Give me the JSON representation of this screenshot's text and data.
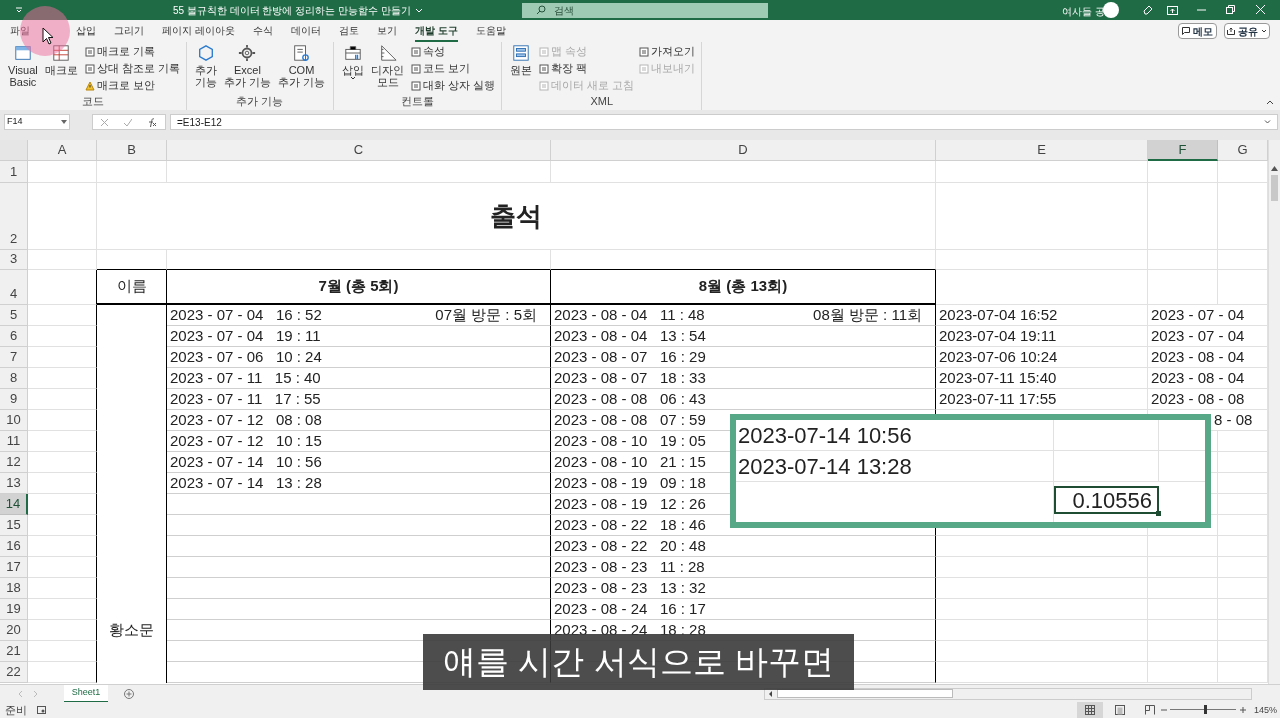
{
  "title_bar": {
    "title": "55 불규칙한 데이터 한방에 정리하는 만능함수 만들기",
    "search_placeholder": "검색",
    "user": "여사들 공"
  },
  "menu_tabs": [
    {
      "label": "파일",
      "selected": false
    },
    {
      "label": "삽입",
      "selected": false
    },
    {
      "label": "그리기",
      "selected": false
    },
    {
      "label": "페이지 레이아웃",
      "selected": false
    },
    {
      "label": "수식",
      "selected": false
    },
    {
      "label": "데이터",
      "selected": false
    },
    {
      "label": "검토",
      "selected": false
    },
    {
      "label": "보기",
      "selected": false
    },
    {
      "label": "개발 도구",
      "selected": true
    },
    {
      "label": "도움말",
      "selected": false
    }
  ],
  "memo_button": "메모",
  "share_button": "공유",
  "ribbon_groups": [
    {
      "label": "코드",
      "columns": [
        {
          "kind": "large",
          "label": "Visual\nBasic",
          "dropdown": false
        },
        {
          "kind": "large",
          "label": "매크로",
          "dropdown": false
        },
        {
          "kind": "stack",
          "items": [
            {
              "label": "매크로 기록",
              "disabled": false
            },
            {
              "label": "상대 참조로 기록",
              "disabled": false
            },
            {
              "label": "매크로 보안",
              "disabled": false
            }
          ]
        }
      ]
    },
    {
      "label": "추가 기능",
      "columns": [
        {
          "kind": "large",
          "label": "추가\n기능",
          "dropdown": false
        },
        {
          "kind": "large",
          "label": "Excel\n추가 기능",
          "dropdown": false
        },
        {
          "kind": "large",
          "label": "COM\n추가 기능",
          "dropdown": false
        }
      ]
    },
    {
      "label": "컨트롤",
      "columns": [
        {
          "kind": "large",
          "label": "삽입",
          "dropdown": true
        },
        {
          "kind": "large",
          "label": "디자인\n모드",
          "dropdown": false
        },
        {
          "kind": "stack",
          "items": [
            {
              "label": "속성",
              "disabled": false
            },
            {
              "label": "코드 보기",
              "disabled": false
            },
            {
              "label": "대화 상자 실행",
              "disabled": false
            }
          ]
        }
      ]
    },
    {
      "label": "XML",
      "columns": [
        {
          "kind": "large",
          "label": "원본",
          "dropdown": false
        },
        {
          "kind": "stack",
          "items": [
            {
              "label": "맵 속성",
              "disabled": true
            },
            {
              "label": "확장 팩",
              "disabled": false
            },
            {
              "label": "데이터 새로 고침",
              "disabled": true
            }
          ]
        },
        {
          "kind": "stack",
          "items": [
            {
              "label": "가져오기",
              "disabled": false
            },
            {
              "label": "내보내기",
              "disabled": true
            }
          ]
        }
      ]
    }
  ],
  "name_box": "F14",
  "formula": "=E13-E12",
  "columns": [
    {
      "label": "A",
      "selected": false
    },
    {
      "label": "B",
      "selected": false
    },
    {
      "label": "C",
      "selected": false
    },
    {
      "label": "D",
      "selected": false
    },
    {
      "label": "E",
      "selected": false
    },
    {
      "label": "F",
      "selected": true
    },
    {
      "label": "G",
      "selected": false
    }
  ],
  "rows": [
    {
      "header": "1",
      "selected": false
    },
    {
      "header": "2",
      "selected": false,
      "title": "출석"
    },
    {
      "header": "3",
      "selected": false
    },
    {
      "header": "4",
      "selected": false,
      "b": "이름",
      "c": "7월 (총 5회)",
      "d": "8월 (총 13회)"
    },
    {
      "header": "5",
      "selected": false,
      "c": "2023 - 07 - 04   16 : 52",
      "c_note": "07월 방문 : 5회",
      "d": "2023 - 08 - 04   11 : 48",
      "d_note": "08월 방문 : 11회",
      "e": "2023-07-04 16:52",
      "f": "2023 - 07 - 04"
    },
    {
      "header": "6",
      "selected": false,
      "c": "2023 - 07 - 04   19 : 11",
      "d": "2023 - 08 - 04   13 : 54",
      "e": "2023-07-04 19:11",
      "f": "2023 - 07 - 04"
    },
    {
      "header": "7",
      "selected": false,
      "c": "2023 - 07 - 06   10 : 24",
      "d": "2023 - 08 - 07   16 : 29",
      "e": "2023-07-06 10:24",
      "f": "2023 - 08 - 04"
    },
    {
      "header": "8",
      "selected": false,
      "c": "2023 - 07 - 11   15 : 40",
      "d": "2023 - 08 - 07   18 : 33",
      "e": "2023-07-11 15:40",
      "f": "2023 - 08 - 04"
    },
    {
      "header": "9",
      "selected": false,
      "c": "2023 - 07 - 11   17 : 55",
      "d": "2023 - 08 - 08   06 : 43",
      "e": "2023-07-11 17:55",
      "f": "2023 - 08 - 08"
    },
    {
      "header": "10",
      "selected": false,
      "c": "2023 - 07 - 12   08 : 08",
      "d": "2023 - 08 - 08   07 : 59",
      "f_partial": "8 - 08"
    },
    {
      "header": "11",
      "selected": false,
      "c": "2023 - 07 - 12   10 : 15",
      "d": "2023 - 08 - 10   19 : 05"
    },
    {
      "header": "12",
      "selected": false,
      "c": "2023 - 07 - 14   10 : 56",
      "d": "2023 - 08 - 10   21 : 15"
    },
    {
      "header": "13",
      "selected": false,
      "c": "2023 - 07 - 14   13 : 28",
      "d": "2023 - 08 - 19   09 : 18"
    },
    {
      "header": "14",
      "selected": true,
      "d": "2023 - 08 - 19   12 : 26"
    },
    {
      "header": "15",
      "selected": false,
      "d": "2023 - 08 - 22   18 : 46"
    },
    {
      "header": "16",
      "selected": false,
      "d": "2023 - 08 - 22   20 : 48"
    },
    {
      "header": "17",
      "selected": false,
      "d": "2023 - 08 - 23   11 : 28"
    },
    {
      "header": "18",
      "selected": false,
      "d": "2023 - 08 - 23   13 : 32"
    },
    {
      "header": "19",
      "selected": false,
      "d": "2023 - 08 - 24   16 : 17"
    },
    {
      "header": "20",
      "selected": false,
      "b": "황소문",
      "d": "2023 - 08 - 24   18 : 28"
    },
    {
      "header": "21",
      "selected": false
    },
    {
      "header": "22",
      "selected": false
    }
  ],
  "callout": {
    "lines": [
      "2023-07-14 10:56",
      "2023-07-14 13:28"
    ],
    "result": "0.10556"
  },
  "caption": "얘를 시간 서식으로 바꾸면",
  "sheet_tabs": [
    {
      "label": "Sheet1",
      "selected": true
    }
  ],
  "status": "준비",
  "views": [
    {
      "kind": "normal",
      "selected": true
    },
    {
      "kind": "page_layout",
      "selected": false
    },
    {
      "kind": "page_break",
      "selected": false
    }
  ],
  "zoom": {
    "level": 0.53,
    "label": "145%"
  }
}
